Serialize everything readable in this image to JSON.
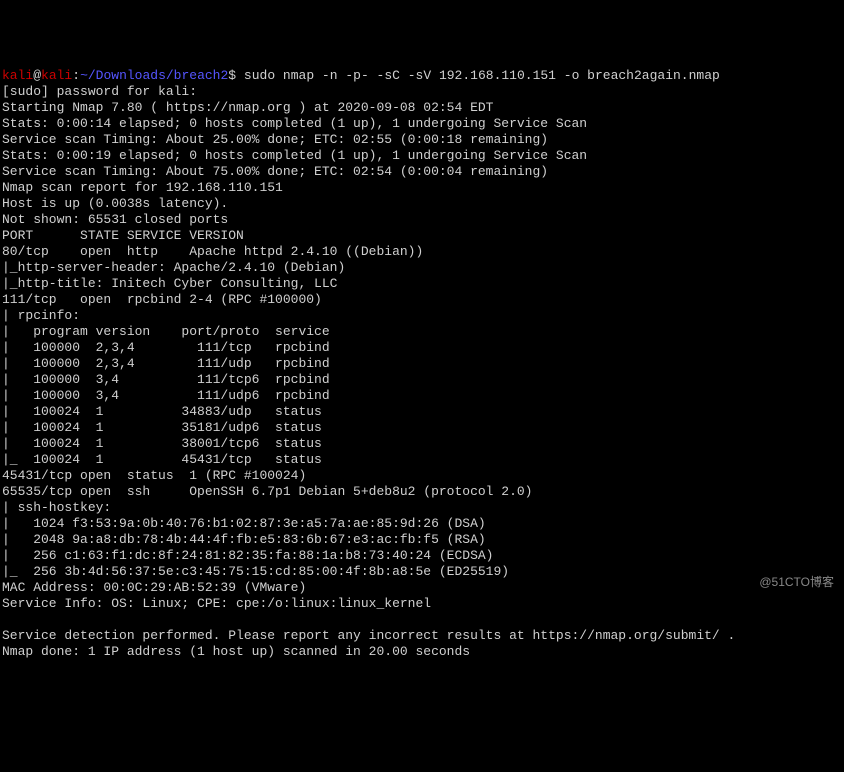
{
  "prompt": {
    "user": "kali",
    "at": "@",
    "host": "kali",
    "colon": ":",
    "path": "~/Downloads/breach2",
    "sign": "$",
    "command": "sudo nmap -n -p- -sC -sV 192.168.110.151 -o breach2again.nmap"
  },
  "lines": {
    "l1": "[sudo] password for kali:",
    "l2": "Starting Nmap 7.80 ( https://nmap.org ) at 2020-09-08 02:54 EDT",
    "l3": "Stats: 0:00:14 elapsed; 0 hosts completed (1 up), 1 undergoing Service Scan",
    "l4": "Service scan Timing: About 25.00% done; ETC: 02:55 (0:00:18 remaining)",
    "l5": "Stats: 0:00:19 elapsed; 0 hosts completed (1 up), 1 undergoing Service Scan",
    "l6": "Service scan Timing: About 75.00% done; ETC: 02:54 (0:00:04 remaining)",
    "l7": "Nmap scan report for 192.168.110.151",
    "l8": "Host is up (0.0038s latency).",
    "l9": "Not shown: 65531 closed ports",
    "l10": "PORT      STATE SERVICE VERSION",
    "l11": "80/tcp    open  http    Apache httpd 2.4.10 ((Debian))",
    "l12": "|_http-server-header: Apache/2.4.10 (Debian)",
    "l13": "|_http-title: Initech Cyber Consulting, LLC",
    "l14": "111/tcp   open  rpcbind 2-4 (RPC #100000)",
    "l15": "| rpcinfo: ",
    "l16": "|   program version    port/proto  service",
    "l17": "|   100000  2,3,4        111/tcp   rpcbind",
    "l18": "|   100000  2,3,4        111/udp   rpcbind",
    "l19": "|   100000  3,4          111/tcp6  rpcbind",
    "l20": "|   100000  3,4          111/udp6  rpcbind",
    "l21": "|   100024  1          34883/udp   status",
    "l22": "|   100024  1          35181/udp6  status",
    "l23": "|   100024  1          38001/tcp6  status",
    "l24": "|_  100024  1          45431/tcp   status",
    "l25": "45431/tcp open  status  1 (RPC #100024)",
    "l26": "65535/tcp open  ssh     OpenSSH 6.7p1 Debian 5+deb8u2 (protocol 2.0)",
    "l27": "| ssh-hostkey: ",
    "l28": "|   1024 f3:53:9a:0b:40:76:b1:02:87:3e:a5:7a:ae:85:9d:26 (DSA)",
    "l29": "|   2048 9a:a8:db:78:4b:44:4f:fb:e5:83:6b:67:e3:ac:fb:f5 (RSA)",
    "l30": "|   256 c1:63:f1:dc:8f:24:81:82:35:fa:88:1a:b8:73:40:24 (ECDSA)",
    "l31": "|_  256 3b:4d:56:37:5e:c3:45:75:15:cd:85:00:4f:8b:a8:5e (ED25519)",
    "l32": "MAC Address: 00:0C:29:AB:52:39 (VMware)",
    "l33": "Service Info: OS: Linux; CPE: cpe:/o:linux:linux_kernel",
    "l34": "",
    "l35": "Service detection performed. Please report any incorrect results at https://nmap.org/submit/ .",
    "l36": "Nmap done: 1 IP address (1 host up) scanned in 20.00 seconds"
  },
  "watermark": "@51CTO博客"
}
